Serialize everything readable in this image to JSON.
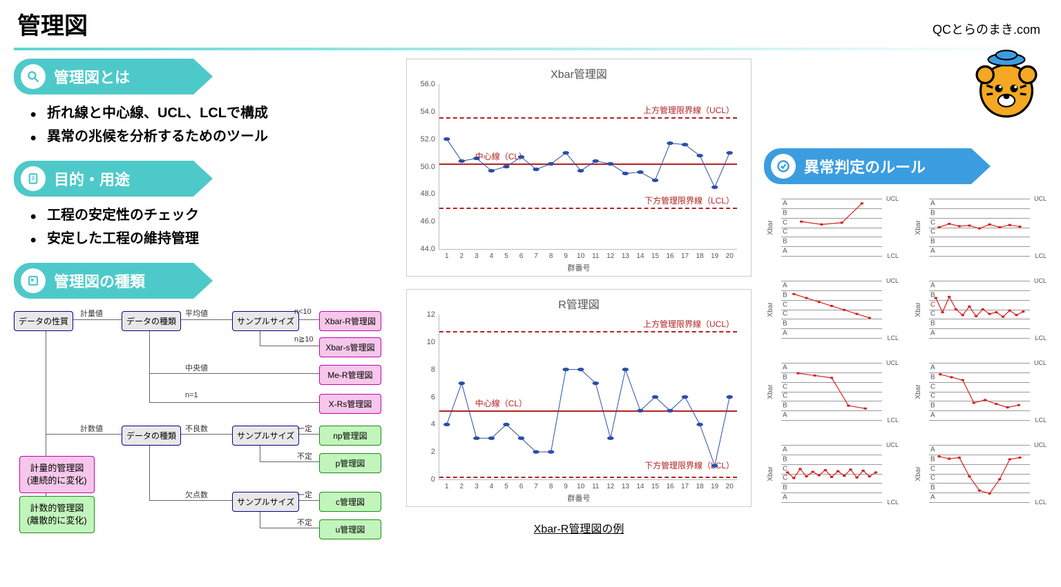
{
  "header": {
    "title": "管理図",
    "site": "QCとらのまき.com"
  },
  "sections": {
    "what": {
      "heading": "管理図とは",
      "bullets": [
        "折れ線と中心線、UCL、LCLで構成",
        "異常の兆候を分析するためのツール"
      ]
    },
    "purpose": {
      "heading": "目的・用途",
      "bullets": [
        "工程の安定性のチェック",
        "安定した工程の維持管理"
      ]
    },
    "types": {
      "heading": "管理図の種類"
    },
    "rules": {
      "heading": "異常判定のルール"
    }
  },
  "tree": {
    "root": "データの性質",
    "edges": {
      "quant": "計量値",
      "count": "計数値",
      "mean": "平均値",
      "median": "中央値",
      "n1": "n=1",
      "defective": "不良数",
      "defect": "欠点数",
      "fixed": "一定",
      "notfixed": "不定",
      "nlt10": "n<10",
      "nge10": "n≧10"
    },
    "nodes": {
      "datakind": "データの種類",
      "sample": "サンプルサイズ"
    },
    "leaves": {
      "xbarr": "Xbar-R管理図",
      "xbars": "Xbar-s管理図",
      "mer": "Me-R管理図",
      "xrs": "X-Rs管理図",
      "np": "np管理図",
      "p": "p管理図",
      "c": "c管理図",
      "u": "u管理図"
    },
    "legend": {
      "quant": "計量的管理図\n(連続的に変化)",
      "count": "計数的管理図\n(離散的に変化)"
    }
  },
  "charts": {
    "xbar": {
      "title": "Xbar管理図",
      "ucl_label": "上方管理限界線（UCL）",
      "cl_label": "中心線（CL）",
      "lcl_label": "下方管理限界線（LCL）",
      "xlabel": "群番号"
    },
    "r": {
      "title": "R管理図",
      "ucl_label": "上方管理限界線（UCL）",
      "cl_label": "中心線（CL）",
      "lcl_label": "下方管理限界線（LCL）",
      "xlabel": "群番号"
    },
    "caption": "Xbar-R管理図の例"
  },
  "mini": {
    "zones": [
      "A",
      "B",
      "C",
      "C",
      "B",
      "A"
    ],
    "ucl": "UCL",
    "lcl": "LCL",
    "y": "Xbar"
  },
  "chart_data": [
    {
      "type": "line",
      "title": "Xbar管理図",
      "xlabel": "群番号",
      "ylabel": "",
      "ylim": [
        44,
        56
      ],
      "categories": [
        1,
        2,
        3,
        4,
        5,
        6,
        7,
        8,
        9,
        10,
        11,
        12,
        13,
        14,
        15,
        16,
        17,
        18,
        19,
        20
      ],
      "series": [
        {
          "name": "Xbar",
          "values": [
            52.0,
            50.4,
            50.6,
            49.7,
            50.0,
            50.7,
            49.8,
            50.2,
            51.0,
            49.7,
            50.4,
            50.2,
            49.5,
            49.6,
            49.0,
            51.7,
            51.6,
            50.8,
            48.5,
            51.0
          ]
        }
      ],
      "reference_lines": {
        "UCL": 53.6,
        "CL": 50.2,
        "LCL": 47.0
      },
      "annotations": [
        "上方管理限界線（UCL）",
        "中心線（CL）",
        "下方管理限界線（LCL）"
      ]
    },
    {
      "type": "line",
      "title": "R管理図",
      "xlabel": "群番号",
      "ylabel": "",
      "ylim": [
        0,
        12
      ],
      "categories": [
        1,
        2,
        3,
        4,
        5,
        6,
        7,
        8,
        9,
        10,
        11,
        12,
        13,
        14,
        15,
        16,
        17,
        18,
        19,
        20
      ],
      "series": [
        {
          "name": "R",
          "values": [
            4,
            7,
            3,
            3,
            4,
            3,
            2,
            2,
            8,
            8,
            7,
            3,
            8,
            5,
            6,
            5,
            6,
            4,
            1,
            6
          ]
        }
      ],
      "reference_lines": {
        "UCL": 10.8,
        "CL": 5.0,
        "LCL": 0.2
      },
      "annotations": [
        "上方管理限界線（UCL）",
        "中心線（CL）",
        "下方管理限界線（LCL）"
      ]
    }
  ]
}
